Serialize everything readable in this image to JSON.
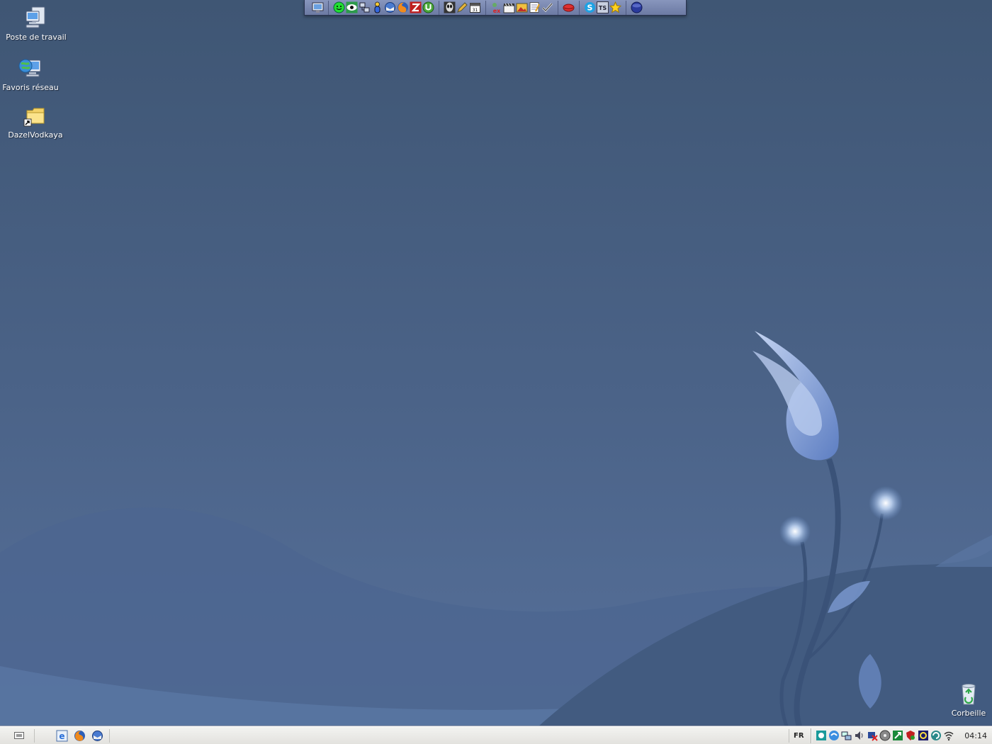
{
  "desktop": {
    "icons": [
      {
        "label": "Poste de travail",
        "icon": "my-computer-icon"
      },
      {
        "label": "Favoris réseau",
        "icon": "network-places-icon"
      },
      {
        "label": "DazelVodkaya",
        "icon": "folder-shortcut-icon"
      },
      {
        "label": "Corbeille",
        "icon": "recycle-bin-icon"
      }
    ]
  },
  "quicklaunch_bar": {
    "groups": [
      [
        "display-settings-icon"
      ],
      [
        "green-smiley-icon",
        "eye-icon",
        "network-tool-icon",
        "messenger-icon",
        "thunderbird-icon",
        "firefox-icon",
        "filezilla-icon",
        "utorrent-icon"
      ],
      [
        "alien-icon",
        "pen-tool-icon",
        "calendar-icon"
      ],
      [
        "ex-tool-icon",
        "clapper-icon",
        "image-editor-icon",
        "notepad-icon",
        "check-tool-icon"
      ],
      [
        "lips-icon"
      ],
      [
        "skype-icon",
        "ts-icon",
        "star-icon"
      ],
      [
        "globe-icon"
      ]
    ]
  },
  "taskbar": {
    "quicklaunch": [
      "ie-icon",
      "firefox-icon",
      "thunderbird-icon"
    ],
    "language": "FR",
    "tray_icons": [
      "tray-app1-icon",
      "tray-app2-icon",
      "tray-network-icon",
      "tray-volume-icon",
      "tray-security-icon",
      "tray-disc-icon",
      "tray-download-icon",
      "tray-shield-icon",
      "tray-monitor-icon",
      "tray-update-icon",
      "tray-wifi-icon"
    ],
    "clock": "04:14"
  },
  "colors": {
    "desktop_top": "#3f5674",
    "desktop_bottom": "#56709a",
    "taskbar": "#ecebe8"
  }
}
